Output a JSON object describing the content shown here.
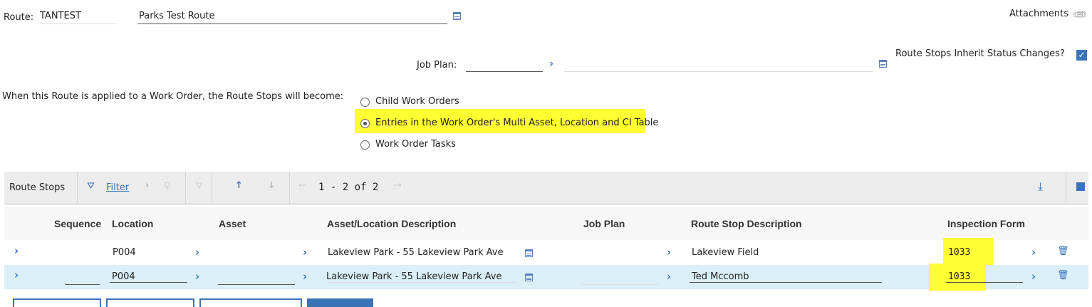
{
  "header": {
    "route_label": "Route:",
    "route_value": "TANTEST",
    "route_description": "Parks Test Route",
    "attachments_label": "Attachments",
    "job_plan_label": "Job Plan:",
    "job_plan_value": "",
    "job_plan_description": "",
    "inherit_label": "Route Stops Inherit Status Changes?",
    "inherit_checked": true
  },
  "apply": {
    "prompt": "When this Route is applied to a Work Order, the Route Stops will become:",
    "options": [
      {
        "label": "Child Work Orders",
        "selected": false
      },
      {
        "label": "Entries in the Work Order's Multi Asset, Location and CI Table",
        "selected": true
      },
      {
        "label": "Work Order Tasks",
        "selected": false
      }
    ]
  },
  "table": {
    "title": "Route Stops",
    "filter_label": "Filter",
    "pagination": "1 - 2 of 2",
    "columns": [
      "Sequence",
      "Location",
      "Asset",
      "Asset/Location Description",
      "Job Plan",
      "Route Stop Description",
      "Inspection Form"
    ],
    "rows": [
      {
        "sequence": "",
        "location": "P004",
        "asset": "",
        "description": "Lakeview Park - 55 Lakeview Park Ave",
        "job_plan": "",
        "route_stop_description": "Lakeview Field",
        "inspection_form": "1033"
      },
      {
        "sequence": "",
        "location": "P004",
        "asset": "",
        "description": "Lakeview Park - 55 Lakeview Park Ave",
        "job_plan": "",
        "route_stop_description": "Ted Mccomb",
        "inspection_form": "1033"
      }
    ]
  },
  "colors": {
    "accent": "#3b73b9",
    "highlight": "#ffff33",
    "selected_row": "#dbeff8"
  }
}
